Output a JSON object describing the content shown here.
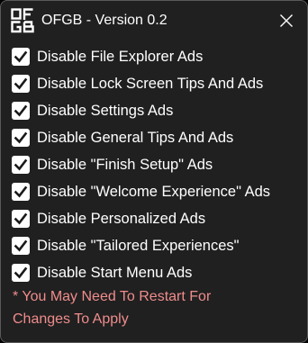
{
  "window": {
    "title": "OFGB - Version 0.2",
    "logo_icon": "ofgb-logo-icon",
    "close_icon": "close-icon"
  },
  "options": [
    {
      "label": "Disable File Explorer Ads",
      "checked": true
    },
    {
      "label": "Disable Lock Screen Tips And Ads",
      "checked": true
    },
    {
      "label": "Disable Settings Ads",
      "checked": true
    },
    {
      "label": "Disable General Tips And Ads",
      "checked": true
    },
    {
      "label": "Disable \"Finish Setup\" Ads",
      "checked": true
    },
    {
      "label": "Disable \"Welcome Experience\" Ads",
      "checked": true
    },
    {
      "label": "Disable Personalized Ads",
      "checked": true
    },
    {
      "label": "Disable \"Tailored Experiences\"",
      "checked": true
    },
    {
      "label": "Disable Start Menu Ads",
      "checked": true
    }
  ],
  "notice": {
    "line1": "* You May Need To Restart For",
    "line2": "Changes To Apply"
  },
  "colors": {
    "background": "#202020",
    "text": "#ffffff",
    "checkbox_fill": "#ffffff",
    "checkmark": "#1a1a1a",
    "notice": "#f08c8c"
  }
}
